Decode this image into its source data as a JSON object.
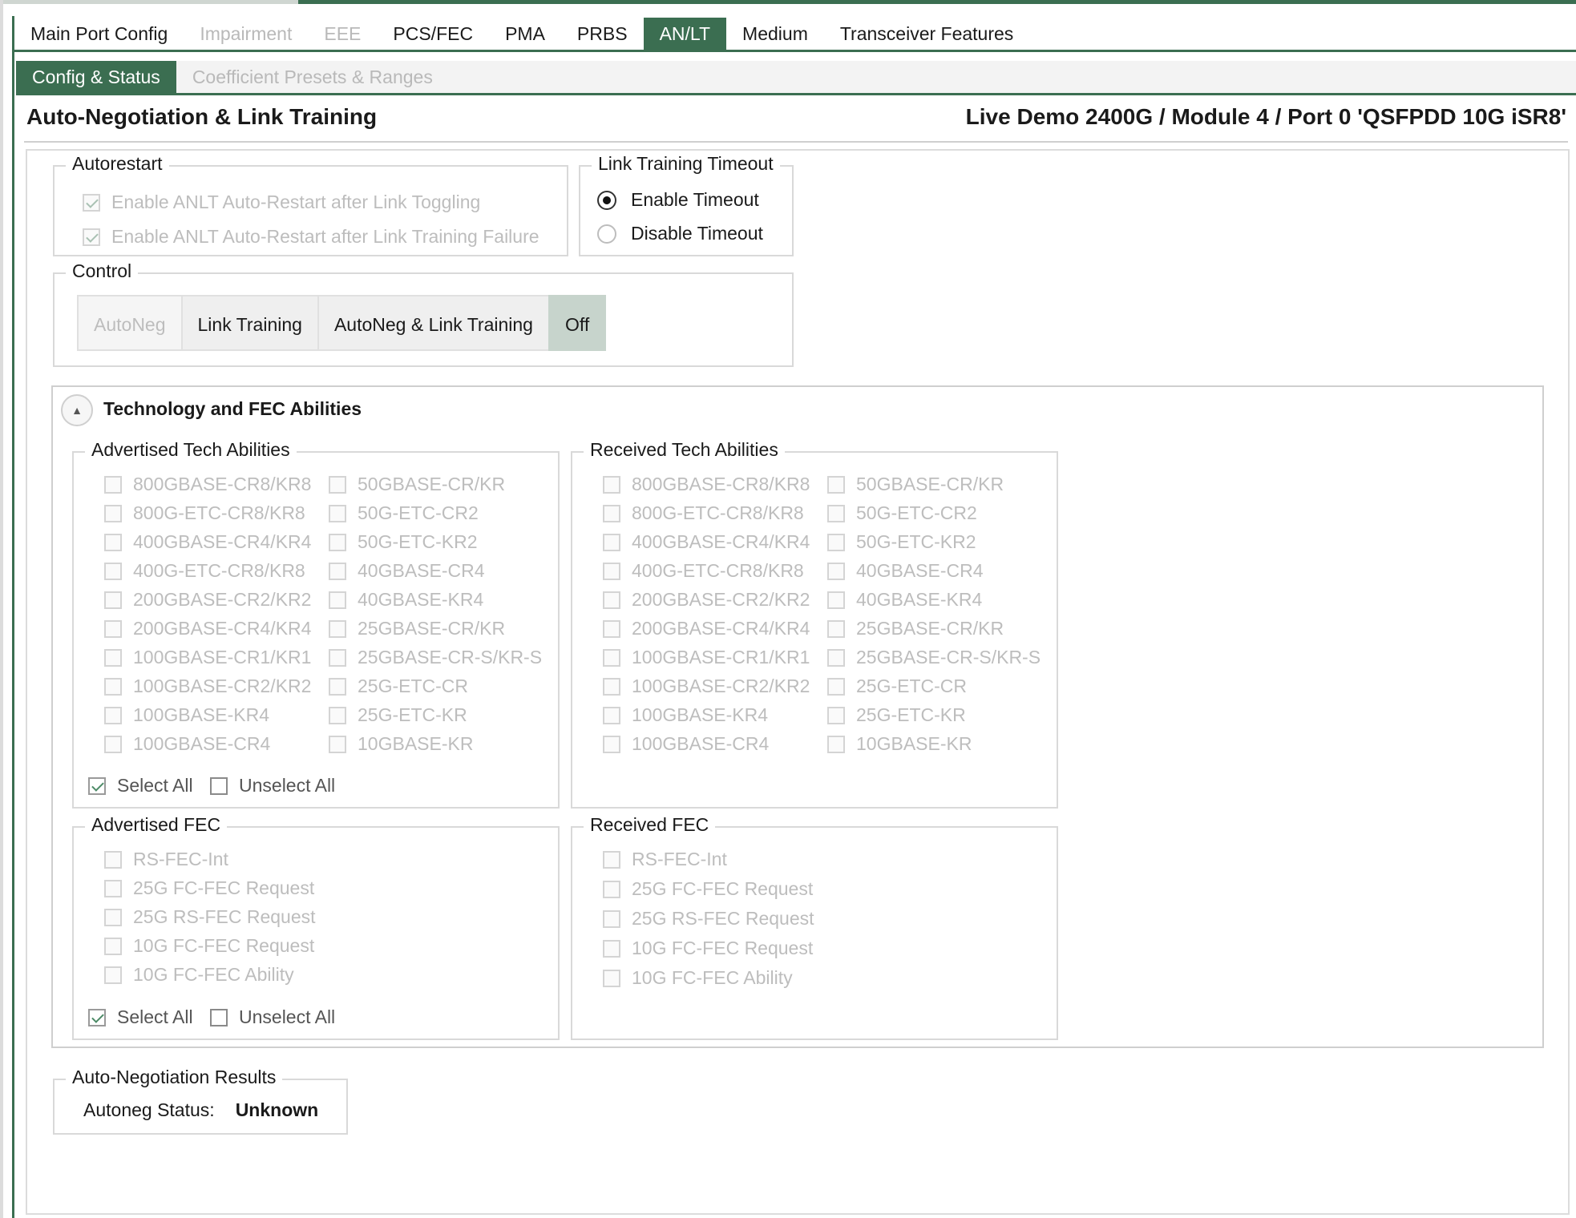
{
  "main_tabs": [
    {
      "label": "Main Port Config",
      "state": "normal"
    },
    {
      "label": "Impairment",
      "state": "disabled"
    },
    {
      "label": "EEE",
      "state": "disabled"
    },
    {
      "label": "PCS/FEC",
      "state": "normal"
    },
    {
      "label": "PMA",
      "state": "normal"
    },
    {
      "label": "PRBS",
      "state": "normal"
    },
    {
      "label": "AN/LT",
      "state": "active"
    },
    {
      "label": "Medium",
      "state": "normal"
    },
    {
      "label": "Transceiver Features",
      "state": "normal"
    }
  ],
  "sub_tabs": [
    {
      "label": "Config & Status",
      "state": "active"
    },
    {
      "label": "Coefficient Presets & Ranges",
      "state": "disabled"
    }
  ],
  "header": {
    "title": "Auto-Negotiation & Link Training",
    "port": "Live Demo 2400G / Module 4 / Port 0 'QSFPDD 10G iSR8'"
  },
  "autorestart": {
    "label": "Autorestart",
    "options": [
      {
        "label": "Enable ANLT Auto-Restart after Link Toggling",
        "checked": true
      },
      {
        "label": "Enable ANLT Auto-Restart after Link Training Failure",
        "checked": true
      }
    ]
  },
  "timeout": {
    "label": "Link Training Timeout",
    "enable": "Enable Timeout",
    "disable": "Disable Timeout",
    "selected": "enable"
  },
  "control": {
    "label": "Control",
    "buttons": [
      {
        "label": "AutoNeg",
        "state": "disabled"
      },
      {
        "label": "Link Training",
        "state": "normal"
      },
      {
        "label": "AutoNeg & Link Training",
        "state": "normal"
      },
      {
        "label": "Off",
        "state": "selected"
      }
    ]
  },
  "tech": {
    "title": "Technology and FEC Abilities",
    "advertised_label": "Advertised Tech Abilities",
    "received_label": "Received Tech Abilities",
    "col1": [
      "800GBASE-CR8/KR8",
      "800G-ETC-CR8/KR8",
      "400GBASE-CR4/KR4",
      "400G-ETC-CR8/KR8",
      "200GBASE-CR2/KR2",
      "200GBASE-CR4/KR4",
      "100GBASE-CR1/KR1",
      "100GBASE-CR2/KR2",
      "100GBASE-KR4",
      "100GBASE-CR4"
    ],
    "col2": [
      "50GBASE-CR/KR",
      "50G-ETC-CR2",
      "50G-ETC-KR2",
      "40GBASE-CR4",
      "40GBASE-KR4",
      "25GBASE-CR/KR",
      "25GBASE-CR-S/KR-S",
      "25G-ETC-CR",
      "25G-ETC-KR",
      "10GBASE-KR"
    ],
    "select_all": "Select All",
    "unselect_all": "Unselect All",
    "advertised_fec_label": "Advertised FEC",
    "received_fec_label": "Received FEC",
    "fec": [
      "RS-FEC-Int",
      "25G FC-FEC Request",
      "25G RS-FEC Request",
      "10G FC-FEC Request",
      "10G FC-FEC Ability"
    ]
  },
  "results": {
    "label": "Auto-Negotiation Results",
    "status_label": "Autoneg Status:",
    "status_value": "Unknown"
  }
}
